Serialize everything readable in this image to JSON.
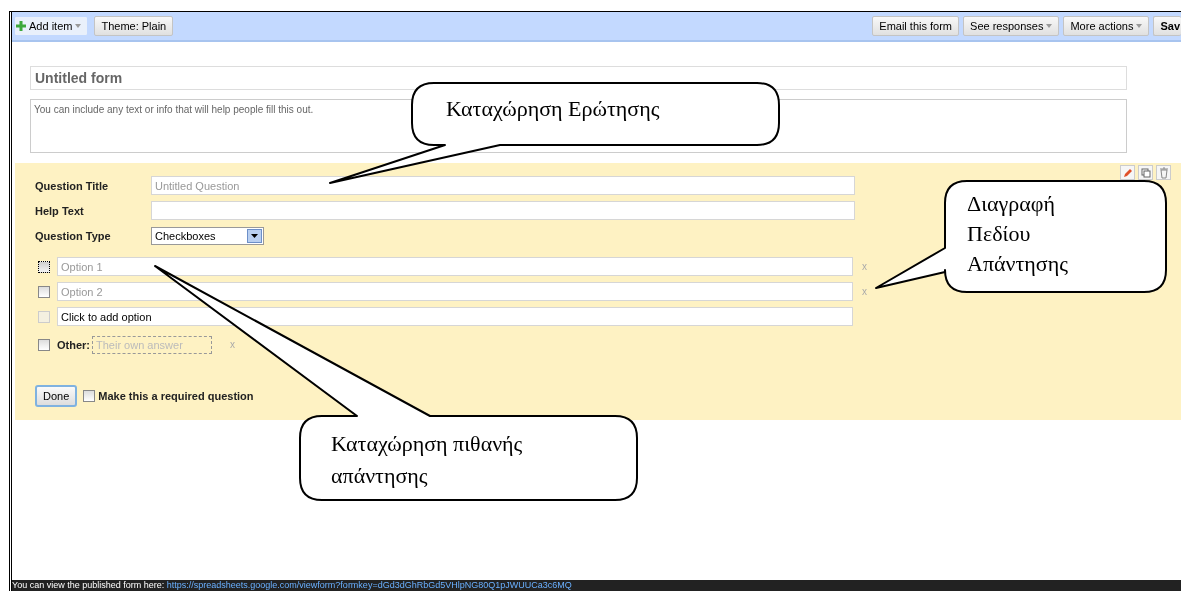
{
  "toolbar": {
    "left_buttons": [
      {
        "label": "Add item",
        "kind": "add"
      },
      {
        "label": "Theme: Plain",
        "kind": "plain"
      }
    ],
    "right_buttons": [
      {
        "label": "Email this form",
        "kind": "plain"
      },
      {
        "label": "See responses",
        "kind": "menu"
      },
      {
        "label": "More actions",
        "kind": "menu"
      },
      {
        "label": "Sav",
        "kind": "plain"
      }
    ]
  },
  "form": {
    "title": "Untitled form",
    "description": {
      "placeholder": "You can include any text or info that will help people fill this out."
    }
  },
  "question": {
    "fields": [
      {
        "label": "Question Title",
        "placeholder": "Untitled Question"
      },
      {
        "label": "Help Text"
      }
    ],
    "type": {
      "label": "Question Type",
      "value": "Checkboxes"
    },
    "options": [
      {
        "kind": "option",
        "placeholder": "Option 1",
        "focused": true,
        "remove": "x"
      },
      {
        "kind": "option",
        "placeholder": "Option 2",
        "focused": false,
        "remove": "x"
      },
      {
        "kind": "add",
        "value": "Click to add option",
        "focused": false
      },
      {
        "kind": "other",
        "label": "Other:",
        "placeholder": "Their own answer",
        "focused": false,
        "remove": "x"
      }
    ],
    "done": "Done",
    "required": {
      "label": "Make this a required question",
      "checked": false
    }
  },
  "footer": {
    "text": "You can view the published form here:",
    "link": "https://spreadsheets.google.com/viewform?formkey=dGd3dGhRbGd5VHlpNG80Q1pJWUUCa3c6MQ"
  },
  "callouts": [
    {
      "text": "Καταχώρηση Ερώτησης"
    },
    {
      "text": "Διαγραφή Πεδίου Απάντησης"
    },
    {
      "text": "Καταχώρηση πιθανής απάντησης"
    }
  ]
}
